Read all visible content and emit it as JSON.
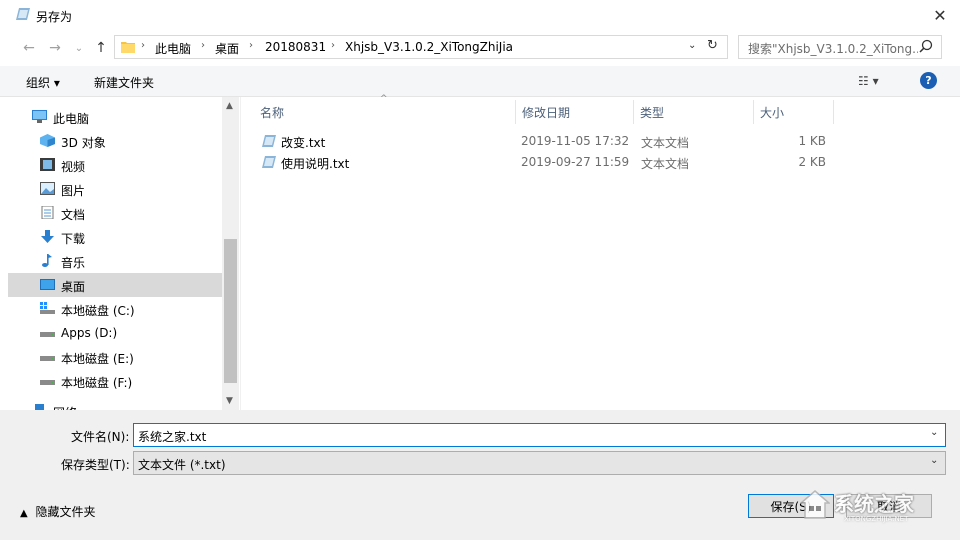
{
  "window": {
    "title": "另存为",
    "close_glyph": "✕"
  },
  "nav": {
    "back_glyph": "←",
    "forward_glyph": "→",
    "recent_glyph": "⌄",
    "up_glyph": "↑",
    "breadcrumb": [
      "此电脑",
      "桌面",
      "20180831",
      "Xhjsb_V3.1.0.2_XiTongZhiJia"
    ],
    "refresh_glyph": "↻",
    "search_placeholder": "搜索\"Xhjsb_V3.1.0.2_XiTong...",
    "search_icon": "search-icon"
  },
  "toolbar": {
    "organize_label": "组织 ▾",
    "new_folder_label": "新建文件夹",
    "view_glyph": "☷ ▾",
    "help_glyph": "?"
  },
  "sidebar": {
    "items": [
      {
        "label": "此电脑",
        "icon": "computer-icon",
        "indent": false
      },
      {
        "label": "3D 对象",
        "icon": "cube-icon",
        "indent": true
      },
      {
        "label": "视频",
        "icon": "video-icon",
        "indent": true
      },
      {
        "label": "图片",
        "icon": "picture-icon",
        "indent": true
      },
      {
        "label": "文档",
        "icon": "document-icon",
        "indent": true
      },
      {
        "label": "下载",
        "icon": "download-icon",
        "indent": true
      },
      {
        "label": "音乐",
        "icon": "music-icon",
        "indent": true
      },
      {
        "label": "桌面",
        "icon": "desktop-icon",
        "indent": true,
        "selected": true
      },
      {
        "label": "本地磁盘 (C:)",
        "icon": "windows-drive-icon",
        "indent": true
      },
      {
        "label": "Apps (D:)",
        "icon": "drive-icon",
        "indent": true
      },
      {
        "label": "本地磁盘 (E:)",
        "icon": "drive-icon",
        "indent": true
      },
      {
        "label": "本地磁盘 (F:)",
        "icon": "drive-icon",
        "indent": true
      },
      {
        "label": "网络",
        "icon": "network-icon",
        "indent": false
      }
    ]
  },
  "file_list": {
    "columns": [
      "名称",
      "修改日期",
      "类型",
      "大小"
    ],
    "rows": [
      {
        "name": "改变.txt",
        "modified": "2019-11-05 17:32",
        "type": "文本文档",
        "size": "1 KB"
      },
      {
        "name": "使用说明.txt",
        "modified": "2019-09-27 11:59",
        "type": "文本文档",
        "size": "2 KB"
      }
    ]
  },
  "save_form": {
    "filename_label": "文件名(N):",
    "filename_value": "系统之家.txt",
    "filetype_label": "保存类型(T):",
    "filetype_value": "文本文件 (*.txt)",
    "hide_folders_label": "隐藏文件夹",
    "save_button": "保存(S)",
    "cancel_button": "取消"
  },
  "watermark": {
    "text": "系统之家",
    "sub": "XITONGZHIJIA.NET"
  }
}
